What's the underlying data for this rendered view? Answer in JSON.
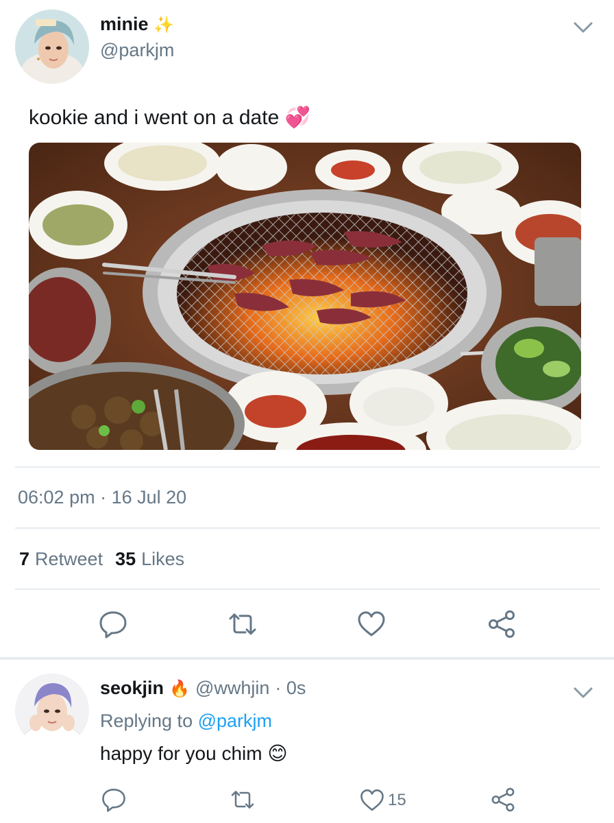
{
  "tweet": {
    "display_name": "minie",
    "name_emoji": "✨",
    "handle": "@parkjm",
    "text": "kookie and i went on a date",
    "text_emoji": "💞",
    "time": "06:02 pm",
    "dot": "·",
    "date": "16 Jul 20",
    "retweet_count": "7",
    "retweet_label": "Retweet",
    "likes_count": "35",
    "likes_label": "Likes"
  },
  "reply": {
    "display_name": "seokjin",
    "name_emoji": "🔥",
    "handle": "@wwhjin",
    "time": "· 0s",
    "replying_prefix": "Replying to",
    "replying_to": "@parkjm",
    "text": "happy for you chim",
    "text_emoji": "😊",
    "like_count": "15"
  },
  "icons": {
    "chevron": "chevron-down-icon",
    "reply": "reply-icon",
    "retweet": "retweet-icon",
    "like": "heart-icon",
    "share": "share-icon"
  },
  "colors": {
    "text": "#14171a",
    "muted": "#657786",
    "link": "#1da1f2",
    "divider": "#e6ecf0"
  }
}
